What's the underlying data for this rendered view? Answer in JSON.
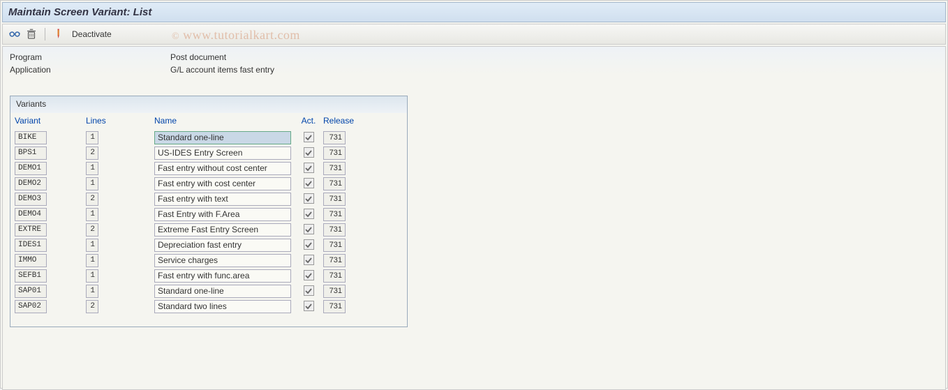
{
  "title": "Maintain Screen Variant: List",
  "toolbar": {
    "deactivate_label": "Deactivate"
  },
  "watermark": "www.tutorialkart.com",
  "info": {
    "program_label": "Program",
    "program_value": "Post document",
    "application_label": "Application",
    "application_value": "G/L account items fast entry"
  },
  "variants": {
    "panel_title": "Variants",
    "headers": {
      "variant": "Variant",
      "lines": "Lines",
      "name": "Name",
      "act": "Act.",
      "release": "Release"
    },
    "rows": [
      {
        "variant": "BIKE",
        "lines": "1",
        "name": "Standard one-line",
        "act": true,
        "release": "731",
        "selected": true
      },
      {
        "variant": "BPS1",
        "lines": "2",
        "name": "US-IDES Entry Screen",
        "act": true,
        "release": "731"
      },
      {
        "variant": "DEMO1",
        "lines": "1",
        "name": "Fast entry without cost center",
        "act": true,
        "release": "731"
      },
      {
        "variant": "DEMO2",
        "lines": "1",
        "name": "Fast entry with cost center",
        "act": true,
        "release": "731"
      },
      {
        "variant": "DEMO3",
        "lines": "2",
        "name": "Fast entry with text",
        "act": true,
        "release": "731"
      },
      {
        "variant": "DEMO4",
        "lines": "1",
        "name": "Fast Entry with F.Area",
        "act": true,
        "release": "731"
      },
      {
        "variant": "EXTRE",
        "lines": "2",
        "name": "Extreme Fast Entry Screen",
        "act": true,
        "release": "731"
      },
      {
        "variant": "IDES1",
        "lines": "1",
        "name": "Depreciation fast entry",
        "act": true,
        "release": "731"
      },
      {
        "variant": "IMMO",
        "lines": "1",
        "name": "Service charges",
        "act": true,
        "release": "731"
      },
      {
        "variant": "SEFB1",
        "lines": "1",
        "name": "Fast entry with func.area",
        "act": true,
        "release": "731"
      },
      {
        "variant": "SAP01",
        "lines": "1",
        "name": "Standard one-line",
        "act": true,
        "release": "731"
      },
      {
        "variant": "SAP02",
        "lines": "2",
        "name": "Standard two lines",
        "act": true,
        "release": "731"
      }
    ]
  }
}
